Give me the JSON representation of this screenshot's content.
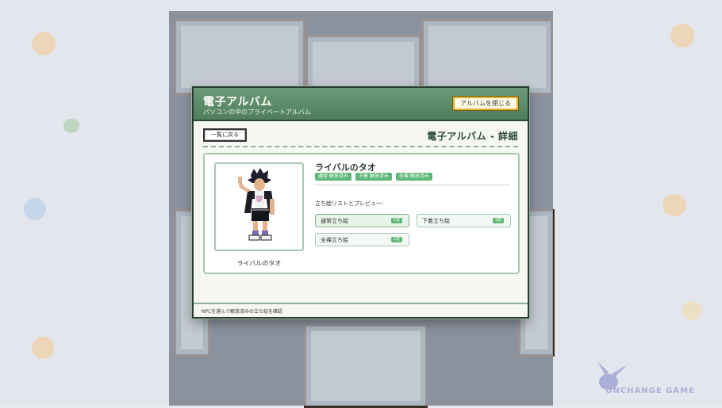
{
  "modal": {
    "title": "電子アルバム",
    "subtitle": "パソコンの中のプライベートアルバム",
    "close_label": "アルバムを閉じる",
    "back_label": "一覧に戻る",
    "section_title": "電子アルバム - 詳細",
    "footer": "NPCを選んで解放済みの立ち絵を確認"
  },
  "character": {
    "name": "ライバルのタオ",
    "portrait_caption": "ライバルのタオ",
    "tags": [
      "通常 解放済み",
      "下着 解放済み",
      "全裸 解放済み"
    ],
    "list_label": "立ち絵リストとプレビュー:",
    "sprites": [
      {
        "label": "通常立ち絵",
        "badge": "1枚",
        "active": true
      },
      {
        "label": "下着立ち絵",
        "badge": "1枚",
        "active": false
      },
      {
        "label": "全裸立ち絵",
        "badge": "1枚",
        "active": false
      }
    ]
  },
  "watermark": {
    "text": "ONCHANGE GAME"
  },
  "colors": {
    "accent_green": "#5fb877",
    "header_green": "#4f7e5c",
    "close_border": "#e3b22e"
  }
}
